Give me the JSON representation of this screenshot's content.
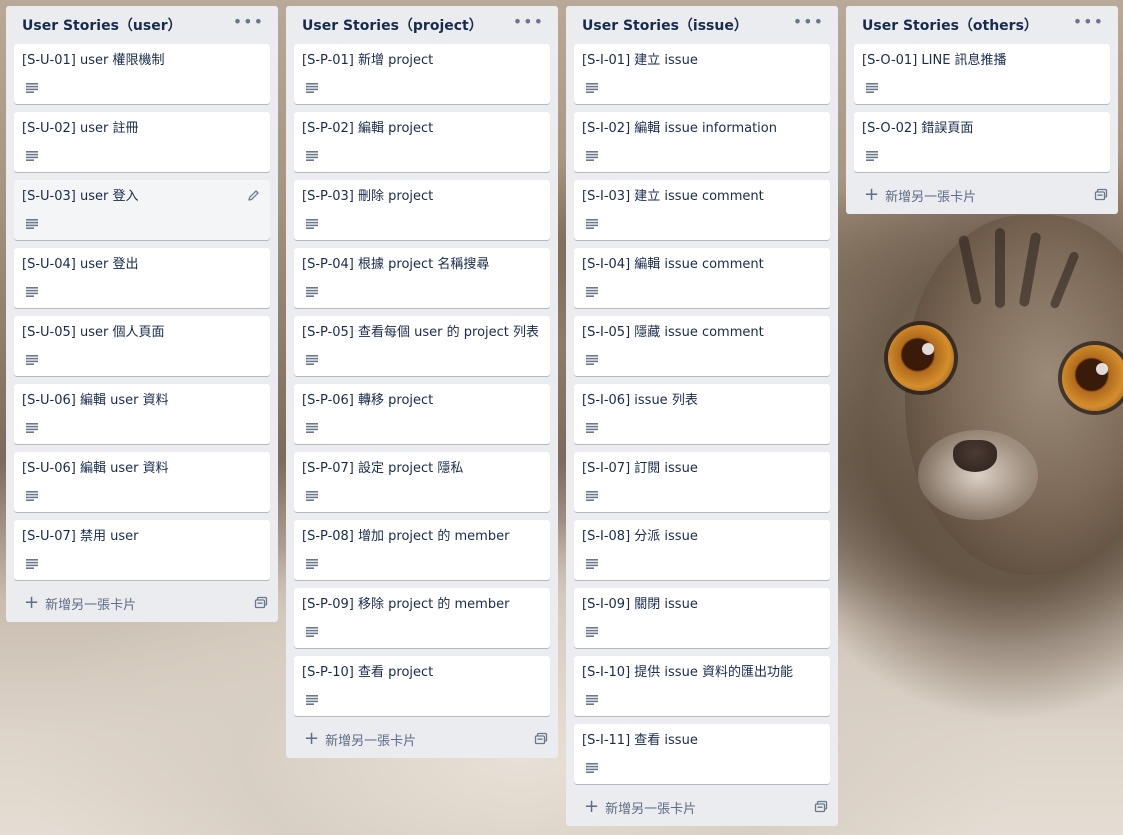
{
  "board": {
    "add_card_label": "新增另一張卡片",
    "lists": [
      {
        "title": "User Stories（user）",
        "cards": [
          "[S-U-01] user 權限機制",
          "[S-U-02] user 註冊",
          "[S-U-03] user 登入",
          "[S-U-04] user 登出",
          "[S-U-05] user 個人頁面",
          "[S-U-06] 編輯 user 資料",
          "[S-U-06] 編輯 user 資料",
          "[S-U-07] 禁用 user"
        ]
      },
      {
        "title": "User Stories（project）",
        "cards": [
          "[S-P-01] 新增 project",
          "[S-P-02] 編輯 project",
          "[S-P-03] 刪除 project",
          "[S-P-04] 根據 project 名稱搜尋",
          "[S-P-05] 查看每個 user 的 project 列表",
          "[S-P-06] 轉移 project",
          "[S-P-07] 設定 project 隱私",
          "[S-P-08] 增加 project 的 member",
          "[S-P-09] 移除 project 的 member",
          "[S-P-10] 查看 project"
        ]
      },
      {
        "title": "User Stories（issue）",
        "cards": [
          "[S-I-01] 建立 issue",
          "[S-I-02] 編輯 issue information",
          "[S-I-03] 建立 issue comment",
          "[S-I-04] 編輯 issue comment",
          "[S-I-05] 隱藏 issue comment",
          "[S-I-06] issue 列表",
          "[S-I-07] 訂閱 issue",
          "[S-I-08] 分派 issue",
          "[S-I-09] 關閉 issue",
          "[S-I-10] 提供 issue 資料的匯出功能",
          "[S-I-11] 查看 issue"
        ]
      },
      {
        "title": "User Stories（others）",
        "cards": [
          "[S-O-01] LINE 訊息推播",
          "[S-O-02] 錯誤頁面"
        ]
      }
    ]
  },
  "icons": {
    "list_menu": "ellipsis-icon",
    "card_description": "description-lines-icon",
    "card_edit": "pencil-icon",
    "add": "plus-icon",
    "template": "card-template-icon"
  },
  "colors": {
    "list_bg": "#ebecf0",
    "card_bg": "#ffffff",
    "text": "#172b4d",
    "muted": "#5e6c84"
  }
}
